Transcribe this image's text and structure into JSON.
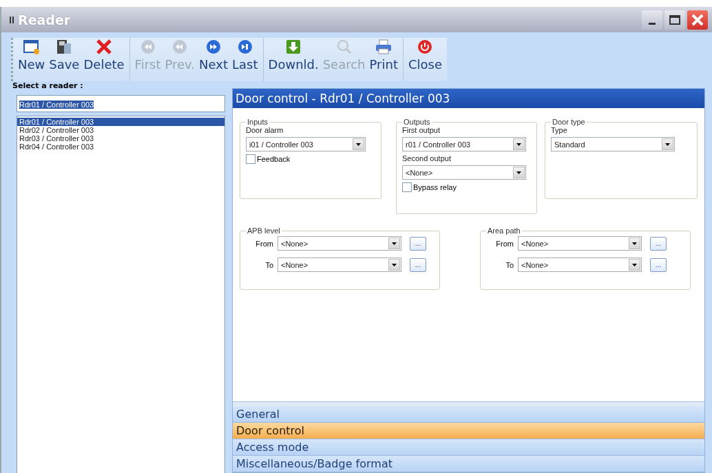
{
  "window": {
    "title": "Reader"
  },
  "toolbar": {
    "groups": [
      [
        {
          "label": "New",
          "disabled": false
        },
        {
          "label": "Save",
          "disabled": false
        },
        {
          "label": "Delete",
          "disabled": false
        }
      ],
      [
        {
          "label": "First",
          "disabled": true
        },
        {
          "label": "Prev.",
          "disabled": true
        },
        {
          "label": "Next",
          "disabled": false
        },
        {
          "label": "Last",
          "disabled": false
        }
      ],
      [
        {
          "label": "Downld.",
          "disabled": false
        },
        {
          "label": "Search",
          "disabled": true
        },
        {
          "label": "Print",
          "disabled": false
        }
      ],
      [
        {
          "label": "Close",
          "disabled": false
        }
      ]
    ]
  },
  "reader_panel": {
    "label": "Select a reader :",
    "search_value": "Rdr01 / Controller 003",
    "items": [
      {
        "label": "Rdr01 / Controller 003",
        "selected": true
      },
      {
        "label": "Rdr02 / Controller 003",
        "selected": false
      },
      {
        "label": "Rdr03 / Controller 003",
        "selected": false
      },
      {
        "label": "Rdr04 / Controller 003",
        "selected": false
      }
    ]
  },
  "detail": {
    "title": "Door control - Rdr01 / Controller 003",
    "inputs": {
      "legend": "Inputs",
      "door_alarm_label": "Door alarm",
      "door_alarm_value": "i01 / Controller 003",
      "feedback": {
        "label": "Feedback",
        "checked": false
      }
    },
    "outputs": {
      "legend": "Outputs",
      "first_label": "First output",
      "first_value": "r01 / Controller 003",
      "second_label": "Second output",
      "second_value": "<None>",
      "bypass": {
        "label": "Bypass relay",
        "checked": false
      }
    },
    "door_type": {
      "legend": "Door type",
      "type_label": "Type",
      "type_value": "Standard"
    },
    "apb_level": {
      "legend": "APB level",
      "rows": [
        {
          "label": "From",
          "value": "<None>",
          "button": "..."
        },
        {
          "label": "To",
          "value": "<None>",
          "button": "..."
        }
      ]
    },
    "area_path": {
      "legend": "Area path",
      "rows": [
        {
          "label": "From",
          "value": "<None>",
          "button": "..."
        },
        {
          "label": "To",
          "value": "<None>",
          "button": "..."
        }
      ]
    }
  },
  "sections": [
    {
      "label": "General",
      "selected": false
    },
    {
      "label": "Door control",
      "selected": true
    },
    {
      "label": "Access mode",
      "selected": false
    },
    {
      "label": "Miscellaneous/Badge format",
      "selected": false
    }
  ]
}
